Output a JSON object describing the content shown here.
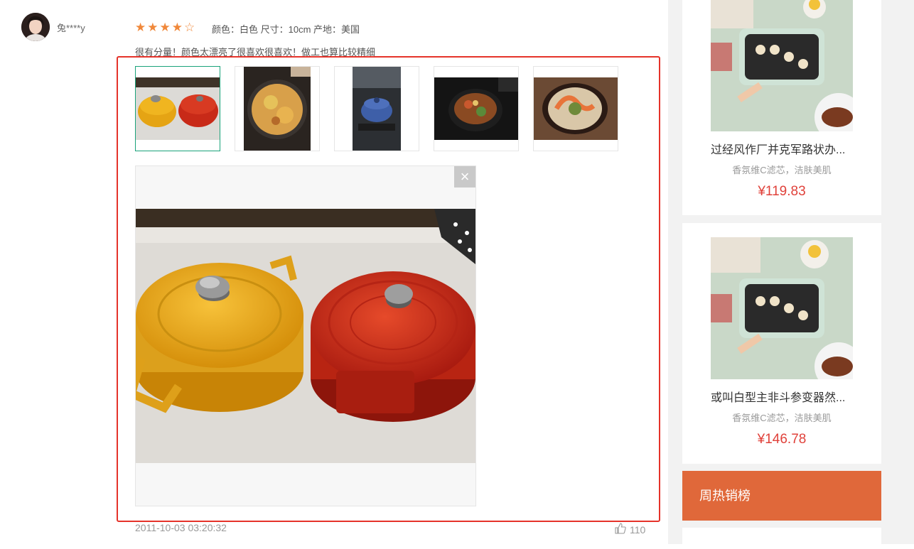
{
  "review": {
    "username": "兔****y",
    "rating": 4,
    "max_rating": 5,
    "attributes": "颜色：白色 尺寸：10cm 产地：美国",
    "text": "很有分量！颜色太漂亮了很喜欢很喜欢！做工也算比较精细",
    "thumbnails": [
      {
        "icon": "pots-photo"
      },
      {
        "icon": "pizza-photo"
      },
      {
        "icon": "blue-pot-photo"
      },
      {
        "icon": "stew-photo"
      },
      {
        "icon": "noodle-bowl-photo"
      }
    ],
    "active_thumbnail": 0,
    "close_symbol": "×",
    "timestamp": "2011-10-03 03:20:32",
    "likes": "110"
  },
  "sidebar": {
    "products": [
      {
        "title": "过经风作厂并克军路状办...",
        "subtitle": "香氛维C滤芯，洁肤美肌",
        "price": "¥119.83"
      },
      {
        "title": "或叫白型主非斗参变器然...",
        "subtitle": "香氛维C滤芯，洁肤美肌",
        "price": "¥146.78"
      }
    ],
    "rank_header": "周热销榜"
  },
  "colors": {
    "accent_orange": "#e0683a",
    "price_red": "#e0413a",
    "highlight_red": "#e5332a",
    "star": "#f0883a",
    "active_thumb_border": "#1aa37a"
  }
}
